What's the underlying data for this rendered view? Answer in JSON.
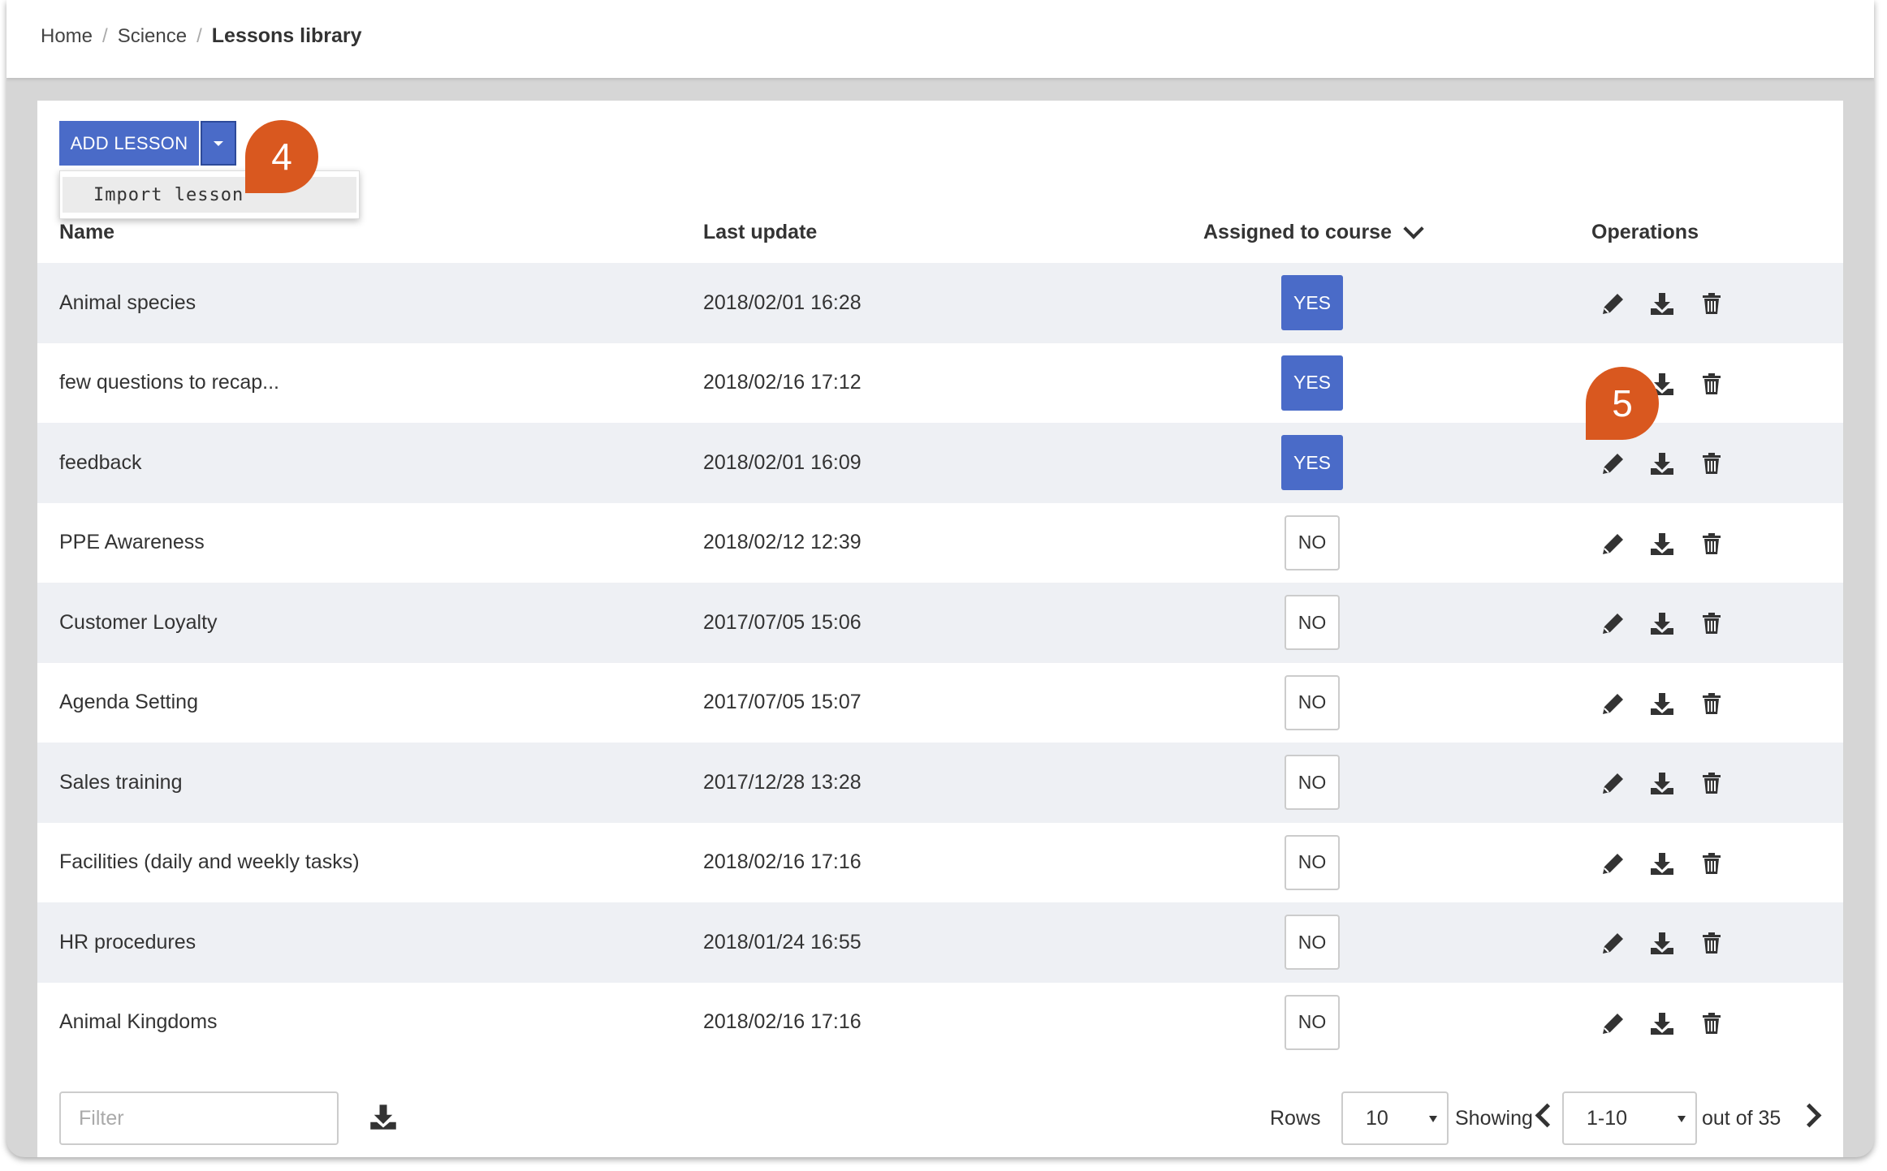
{
  "breadcrumb": {
    "items": [
      "Home",
      "Science"
    ],
    "current": "Lessons library"
  },
  "toolbar": {
    "add_lesson_label": "ADD LESSON",
    "dropdown_items": [
      "Import lesson"
    ]
  },
  "table": {
    "headers": {
      "name": "Name",
      "last_update": "Last update",
      "assigned": "Assigned to course",
      "operations": "Operations"
    },
    "rows": [
      {
        "name": "Animal species",
        "updated": "2018/02/01 16:28",
        "assigned": "YES"
      },
      {
        "name": "few questions to recap...",
        "updated": "2018/02/16 17:12",
        "assigned": "YES"
      },
      {
        "name": "feedback",
        "updated": "2018/02/01 16:09",
        "assigned": "YES"
      },
      {
        "name": "PPE Awareness",
        "updated": "2018/02/12 12:39",
        "assigned": "NO"
      },
      {
        "name": "Customer Loyalty",
        "updated": "2017/07/05 15:06",
        "assigned": "NO"
      },
      {
        "name": "Agenda Setting",
        "updated": "2017/07/05 15:07",
        "assigned": "NO"
      },
      {
        "name": "Sales training",
        "updated": "2017/12/28 13:28",
        "assigned": "NO"
      },
      {
        "name": "Facilities (daily and weekly tasks)",
        "updated": "2018/02/16 17:16",
        "assigned": "NO"
      },
      {
        "name": "HR procedures",
        "updated": "2018/01/24 16:55",
        "assigned": "NO"
      },
      {
        "name": "Animal Kingdoms",
        "updated": "2018/02/16 17:16",
        "assigned": "NO"
      }
    ]
  },
  "footer": {
    "filter_placeholder": "Filter",
    "rows_label": "Rows",
    "rows_value": "10",
    "showing_label": "Showing",
    "showing_value": "1-10",
    "total_label": "out of 35"
  },
  "callouts": [
    "4",
    "5"
  ],
  "colors": {
    "primary": "#4a6bc8",
    "callout": "#d9581f",
    "row_alt": "#eef0f4"
  }
}
